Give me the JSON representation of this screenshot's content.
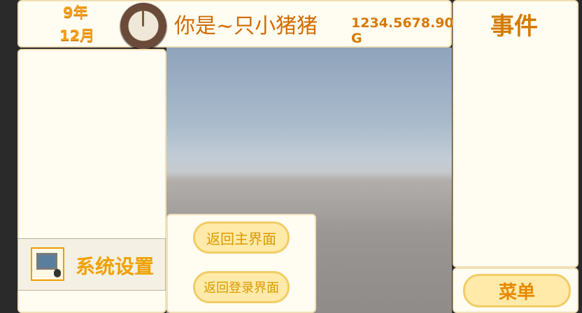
{
  "topbar": {
    "year": "9年",
    "month": "12月",
    "player_name": "你是~只小猪猪",
    "money": "1234.5678.90 G"
  },
  "events": {
    "title": "事件"
  },
  "sidebar": {
    "settings_label": "系统设置"
  },
  "popup": {
    "back_main": "返回主界面",
    "back_login": "返回登录界面"
  },
  "menu": {
    "label": "菜单"
  },
  "colors": {
    "accent": "#f5a01a",
    "panel_bg": "#fffdf2",
    "button_bg": "#ffeaa9"
  }
}
